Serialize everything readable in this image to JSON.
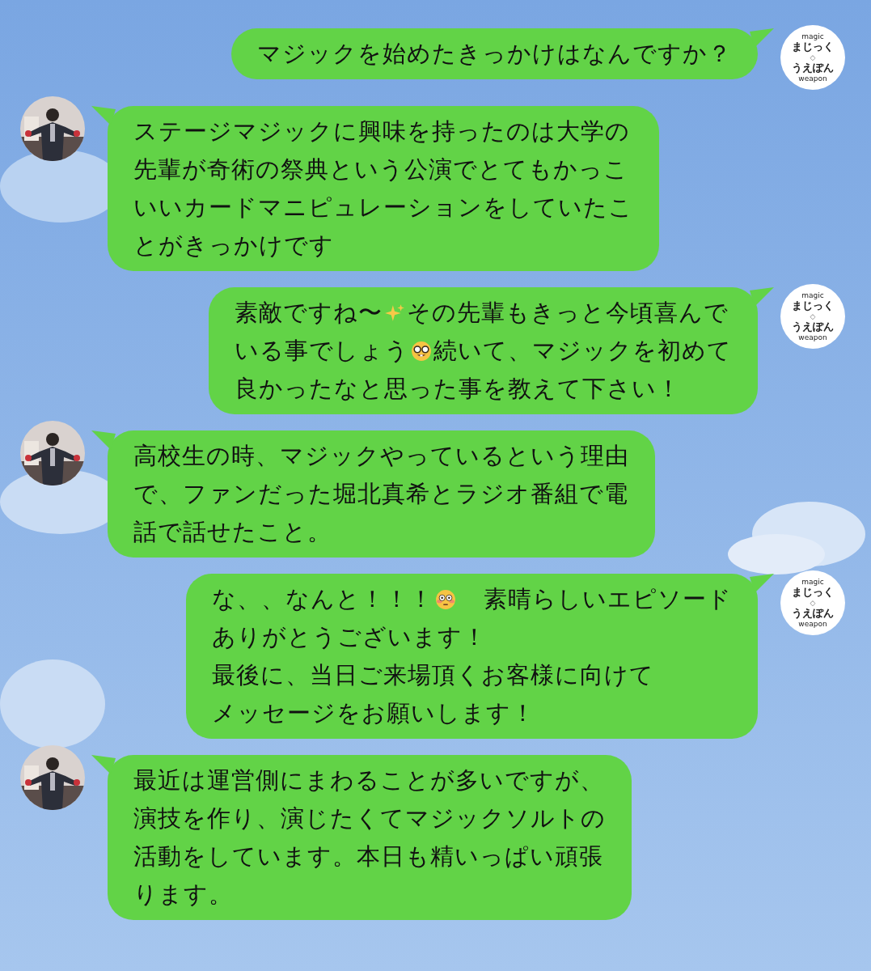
{
  "messages": [
    {
      "kind": "sent",
      "avatar": {
        "top": "magic",
        "title": "まじっく",
        "mark": "◇",
        "subtitle": "うえぽん",
        "bottom": "weapon"
      },
      "lines": [
        [
          {
            "kind": "text",
            "text": "マジックを始めたきっかけはなんですか？"
          }
        ]
      ]
    },
    {
      "kind": "received",
      "lines": [
        [
          {
            "kind": "text",
            "text": "ステージマジックに興味を持ったのは大学の"
          }
        ],
        [
          {
            "kind": "text",
            "text": "先輩が奇術の祭典という公演でとてもかっこ"
          }
        ],
        [
          {
            "kind": "text",
            "text": "いいカードマニピュレーションをしていたこ"
          }
        ],
        [
          {
            "kind": "text",
            "text": "とがきっかけです"
          }
        ]
      ]
    },
    {
      "kind": "sent",
      "avatar": {
        "top": "magic",
        "title": "まじっく",
        "mark": "◇",
        "subtitle": "うえぽん",
        "bottom": "weapon"
      },
      "lines": [
        [
          {
            "kind": "text",
            "text": "素敵ですね〜"
          },
          {
            "kind": "sparkles"
          },
          {
            "kind": "text",
            "text": "その先輩もきっと今頃喜んで"
          }
        ],
        [
          {
            "kind": "text",
            "text": "いる事でしょう"
          },
          {
            "kind": "nerd"
          },
          {
            "kind": "text",
            "text": "続いて、マジックを初めて"
          }
        ],
        [
          {
            "kind": "text",
            "text": "良かったなと思った事を教えて下さい！"
          }
        ]
      ]
    },
    {
      "kind": "received",
      "lines": [
        [
          {
            "kind": "text",
            "text": "高校生の時、マジックやっているという理由"
          }
        ],
        [
          {
            "kind": "text",
            "text": "で、ファンだった堀北真希とラジオ番組で電"
          }
        ],
        [
          {
            "kind": "text",
            "text": "話で話せたこと。"
          }
        ]
      ]
    },
    {
      "kind": "sent",
      "avatar": {
        "top": "magic",
        "title": "まじっく",
        "mark": "◇",
        "subtitle": "うえぽん",
        "bottom": "weapon"
      },
      "lines": [
        [
          {
            "kind": "text",
            "text": "な、、なんと！！！"
          },
          {
            "kind": "flushed"
          },
          {
            "kind": "text",
            "text": "素晴らしいエピソード"
          }
        ],
        [
          {
            "kind": "text",
            "text": "ありがとうございます！"
          }
        ],
        [
          {
            "kind": "text",
            "text": "最後に、当日ご来場頂くお客様に向けて"
          }
        ],
        [
          {
            "kind": "text",
            "text": "メッセージをお願いします！"
          }
        ]
      ]
    },
    {
      "kind": "received",
      "lines": [
        [
          {
            "kind": "text",
            "text": "最近は運営側にまわることが多いですが、"
          }
        ],
        [
          {
            "kind": "text",
            "text": "演技を作り、演じたくてマジックソルトの"
          }
        ],
        [
          {
            "kind": "text",
            "text": "活動をしています。本日も精いっぱい頑張"
          }
        ],
        [
          {
            "kind": "text",
            "text": "ります。"
          }
        ]
      ]
    }
  ]
}
